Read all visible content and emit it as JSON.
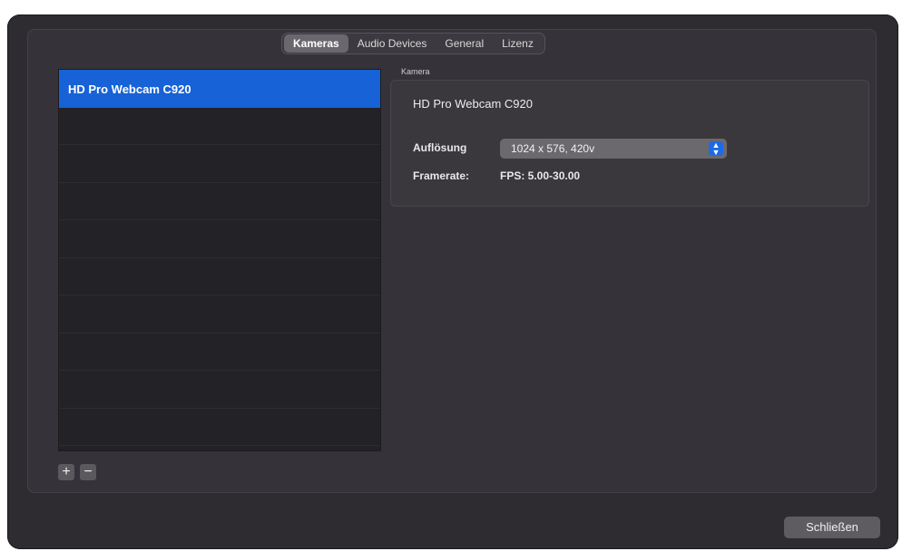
{
  "tabs": [
    {
      "label": "Kameras",
      "active": true
    },
    {
      "label": "Audio Devices",
      "active": false
    },
    {
      "label": "General",
      "active": false
    },
    {
      "label": "Lizenz",
      "active": false
    }
  ],
  "camera_list": {
    "items": [
      "HD Pro Webcam C920",
      "",
      "",
      "",
      "",
      "",
      "",
      "",
      "",
      ""
    ],
    "selected_index": 0
  },
  "list_controls": {
    "add_label": "+",
    "remove_label": "−"
  },
  "camera_group": {
    "label": "Kamera",
    "camera_name": "HD Pro Webcam C920",
    "resolution_label": "Auflösung",
    "resolution_value": "1024 x 576, 420v",
    "framerate_label": "Framerate:",
    "framerate_value": "FPS: 5.00-30.00"
  },
  "footer": {
    "close_label": "Schließen"
  },
  "colors": {
    "accent": "#1662d6",
    "window_bg": "#2e2c30"
  }
}
